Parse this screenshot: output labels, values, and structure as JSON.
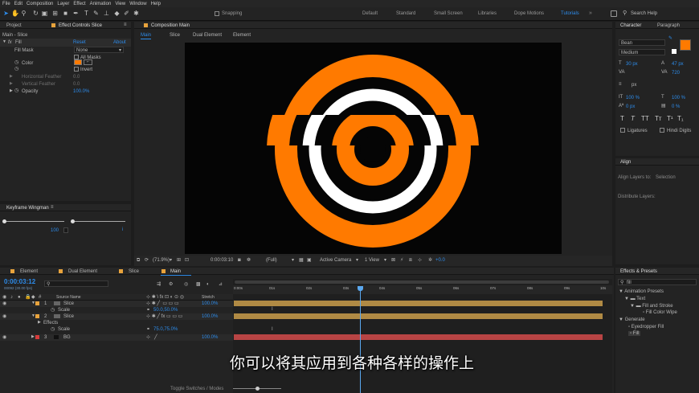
{
  "menu": [
    "File",
    "Edit",
    "Composition",
    "Layer",
    "Effect",
    "Animation",
    "View",
    "Window",
    "Help"
  ],
  "toolbar": {
    "snapping": "Snapping",
    "workspaces": [
      "Default",
      "Standard",
      "Small Screen",
      "Libraries",
      "Dope Motions",
      "Tutorials"
    ],
    "search_placeholder": "Search Help"
  },
  "left_panel": {
    "tabs": [
      "Project",
      "Effect Controls Slice"
    ],
    "header": "Main - Slice",
    "effect": {
      "name": "Fill",
      "reset": "Reset",
      "about": "About",
      "fill_mask_label": "Fill Mask",
      "fill_mask_value": "None",
      "all_masks": "All Masks",
      "color_label": "Color",
      "invert": "Invert",
      "horizontal_feather": "Horizontal Feather",
      "horizontal_feather_value": "0.0",
      "vertical_feather": "Vertical Feather",
      "vertical_feather_value": "0.0",
      "opacity_label": "Opacity",
      "opacity_value": "100.0%",
      "color": "#ff7a00"
    }
  },
  "keyframe_wingman": {
    "title": "Keyframe Wingman",
    "value": "100"
  },
  "comp_viewer": {
    "tab": "Composition Main",
    "breadcrumbs": [
      "Main",
      "Slice",
      "Dual Element",
      "Element"
    ],
    "zoom": "(71.9%)",
    "timecode": "0:00:03:10",
    "resolution": "(Full)",
    "camera": "Active Camera",
    "views": "1 View",
    "offset": "+0.0"
  },
  "character": {
    "tabs": [
      "Character",
      "Paragraph"
    ],
    "font": "Bean",
    "style": "Medium",
    "size": "30 px",
    "leading": "47 px",
    "tracking": "720",
    "stroke": "px",
    "scale_v": "100 %",
    "scale_h": "100 %",
    "baseline": "0 px",
    "tsume": "0 %",
    "buttons": [
      "T",
      "T",
      "TT",
      "Tт",
      "T¹",
      "T₁"
    ],
    "ligatures": "Ligatures",
    "hindi_digits": "Hindi Digits",
    "fill_color": "#ff7a00"
  },
  "align": {
    "title": "Align",
    "align_to_label": "Align Layers to:",
    "align_to": "Selection",
    "distribute": "Distribute Layers:"
  },
  "effects_presets": {
    "title": "Effects & Presets",
    "search": "fill",
    "tree": [
      "Animation Presets",
      "Text",
      "Fill and Stroke",
      "Fill Color Wipe",
      "Generate",
      "Eyedropper Fill",
      "Fill"
    ]
  },
  "timeline": {
    "tabs": [
      "Element",
      "Dual Element",
      "Slice",
      "Main"
    ],
    "timecode": "0:00:03:12",
    "frame_info": "00092 (30.00 fps)",
    "columns": {
      "source": "Source Name",
      "stretch": "Stretch"
    },
    "layers": [
      {
        "num": "1",
        "name": "Slice",
        "color": "#e8a33c",
        "stretch": "100.0%"
      },
      {
        "prop": "Scale",
        "value": "50.0,50.0%"
      },
      {
        "num": "2",
        "name": "Slice",
        "color": "#e8a33c",
        "stretch": "100.0%"
      },
      {
        "prop": "Effects"
      },
      {
        "prop": "Scale",
        "value": "75.0,75.0%"
      },
      {
        "num": "3",
        "name": "BG",
        "color": "#d63b3b",
        "stretch": "100.0%"
      }
    ],
    "ruler": [
      "0:00s",
      "01s",
      "02s",
      "03s",
      "04s",
      "05s",
      "06s",
      "07s",
      "08s",
      "09s",
      "10s"
    ],
    "footer": "Toggle Switches / Modes"
  },
  "subtitle": "你可以将其应用到各种各样的操作上"
}
